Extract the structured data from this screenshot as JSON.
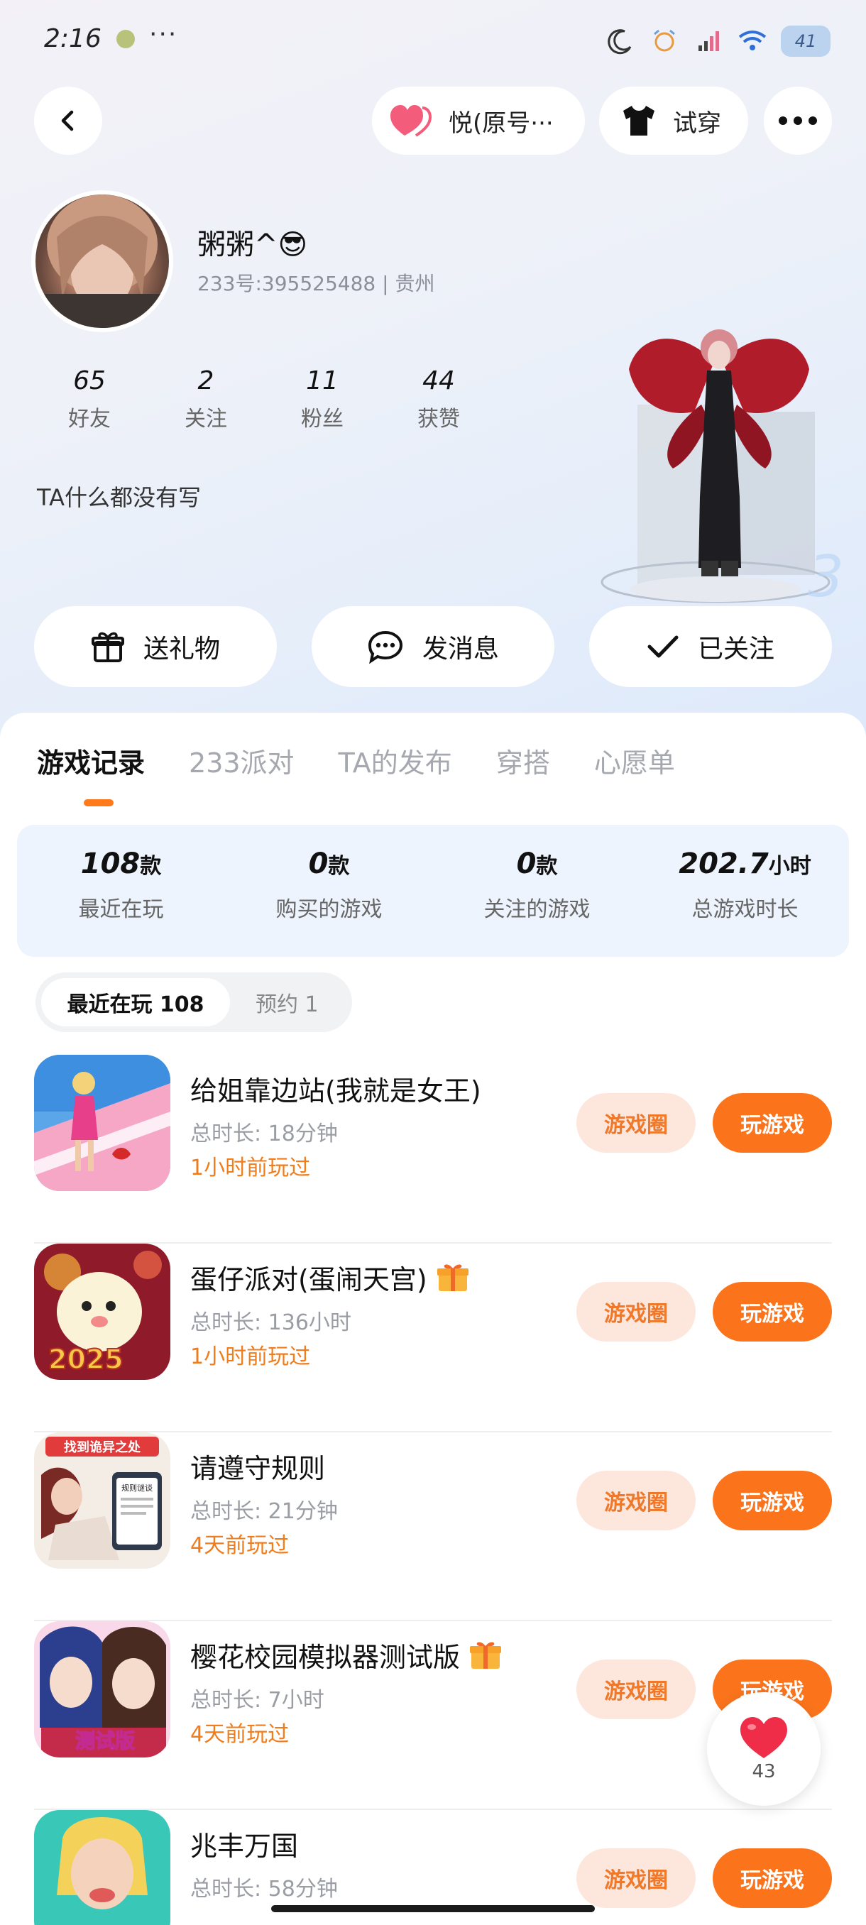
{
  "status_bar": {
    "time": "2:16",
    "more": "···",
    "battery": "41"
  },
  "nav": {
    "mood_label": "悦(原号···",
    "try_on_label": "试穿"
  },
  "profile": {
    "nickname": "粥粥^😎",
    "id_line": "233号:395525488 | 贵州",
    "stats": [
      {
        "value": "65",
        "label": "好友"
      },
      {
        "value": "2",
        "label": "关注"
      },
      {
        "value": "11",
        "label": "粉丝"
      },
      {
        "value": "44",
        "label": "获赞"
      }
    ],
    "bio": "TA什么都没有写"
  },
  "actions": {
    "gift": "送礼物",
    "message": "发消息",
    "follow": "已关注"
  },
  "tabs": [
    "游戏记录",
    "233派对",
    "TA的发布",
    "穿搭",
    "心愿单"
  ],
  "summary": [
    {
      "value": "108",
      "unit": "款",
      "label": "最近在玩"
    },
    {
      "value": "0",
      "unit": "款",
      "label": "购买的游戏"
    },
    {
      "value": "0",
      "unit": "款",
      "label": "关注的游戏"
    },
    {
      "value": "202.7",
      "unit": "小时",
      "label": "总游戏时长"
    }
  ],
  "subtabs": {
    "active": "最近在玩 108",
    "other": "预约 1"
  },
  "games": [
    {
      "title": "给姐靠边站(我就是女王)",
      "duration": "总时长: 18分钟",
      "last_played": "1小时前玩过",
      "gift": false
    },
    {
      "title": "蛋仔派对(蛋闹天宫)",
      "duration": "总时长: 136小时",
      "last_played": "1小时前玩过",
      "gift": true
    },
    {
      "title": "请遵守规则",
      "duration": "总时长: 21分钟",
      "last_played": "4天前玩过",
      "gift": false
    },
    {
      "title": "樱花校园模拟器测试版",
      "duration": "总时长: 7小时",
      "last_played": "4天前玩过",
      "gift": true
    },
    {
      "title": "兆丰万国",
      "duration": "总时长: 58分钟",
      "last_played": "",
      "gift": false
    }
  ],
  "game_buttons": {
    "circle": "游戏圈",
    "play": "玩游戏"
  },
  "game_icon_text": {
    "g2_year": "2025",
    "g3_banner": "找到诡异之处",
    "g3_card": "规则谜谈",
    "g4_badge": "测试版"
  },
  "float_like": {
    "count": "43"
  },
  "colors": {
    "accent": "#fb741c",
    "accent_soft": "#fde7dc",
    "summary_bg": "#eef4fd"
  }
}
